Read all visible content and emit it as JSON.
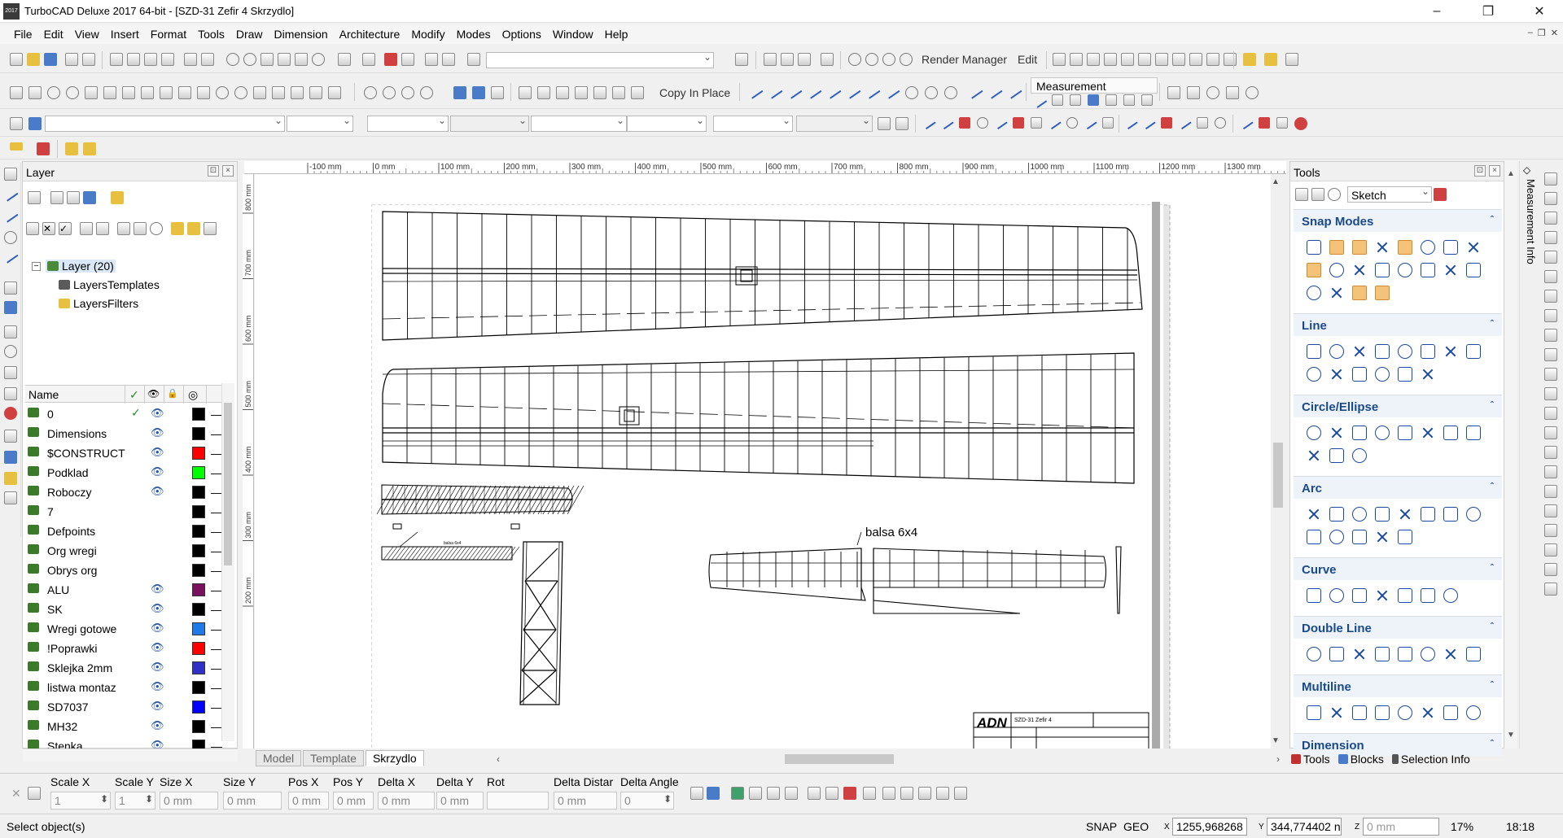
{
  "window": {
    "title": "TurboCAD Deluxe 2017 64-bit - [SZD-31 Zefir 4 Skrzydlo]",
    "icon_text": "2017",
    "minimize": "–",
    "maximize": "❐",
    "close": "✕"
  },
  "menu": [
    "File",
    "Edit",
    "View",
    "Insert",
    "Format",
    "Tools",
    "Draw",
    "Dimension",
    "Architecture",
    "Modify",
    "Modes",
    "Options",
    "Window",
    "Help"
  ],
  "mdi_buttons": [
    "–",
    "❐",
    "✕"
  ],
  "toolbar": {
    "render_manager": "Render Manager",
    "edit": "Edit",
    "copy_in_place": "Copy In Place",
    "measurement": "Measurement"
  },
  "layer_panel": {
    "title": "Layer",
    "tree_root": "Layer (20)",
    "tree_children": [
      "LayersTemplates",
      "LayersFilters"
    ],
    "columns": {
      "name": "Name",
      "check": "✓",
      "eye": "👁",
      "lock": "🔒",
      "color": "◎"
    },
    "rows": [
      {
        "name": "0",
        "current": "✓",
        "visible": "👁",
        "color": "#000000",
        "dash": "—"
      },
      {
        "name": "Dimensions",
        "current": "",
        "visible": "👁",
        "color": "#000000",
        "dash": "—"
      },
      {
        "name": "$CONSTRUCT",
        "current": "",
        "visible": "👁",
        "color": "#ff0000",
        "dash": "—"
      },
      {
        "name": "Podklad",
        "current": "",
        "visible": "👁",
        "color": "#00ff00",
        "dash": "—"
      },
      {
        "name": "Roboczy",
        "current": "",
        "visible": "👁",
        "color": "#000000",
        "dash": "—"
      },
      {
        "name": "7",
        "current": "",
        "visible": "",
        "color": "#000000",
        "dash": "—"
      },
      {
        "name": "Defpoints",
        "current": "",
        "visible": "",
        "color": "#000000",
        "dash": "—"
      },
      {
        "name": "Org wregi",
        "current": "",
        "visible": "",
        "color": "#000000",
        "dash": "—"
      },
      {
        "name": "Obrys org",
        "current": "",
        "visible": "",
        "color": "#000000",
        "dash": "—"
      },
      {
        "name": "ALU",
        "current": "",
        "visible": "👁",
        "color": "#7a1060",
        "dash": "—"
      },
      {
        "name": "SK",
        "current": "",
        "visible": "👁",
        "color": "#000000",
        "dash": "—"
      },
      {
        "name": "Wregi gotowe",
        "current": "",
        "visible": "👁",
        "color": "#1e7ae8",
        "dash": "—"
      },
      {
        "name": "!Poprawki",
        "current": "",
        "visible": "👁",
        "color": "#ff0000",
        "dash": "—"
      },
      {
        "name": "Sklejka 2mm",
        "current": "",
        "visible": "👁",
        "color": "#3030c8",
        "dash": "—"
      },
      {
        "name": "listwa montaz",
        "current": "",
        "visible": "👁",
        "color": "#000000",
        "dash": "—"
      },
      {
        "name": "SD7037",
        "current": "",
        "visible": "👁",
        "color": "#0000ff",
        "dash": "—"
      },
      {
        "name": "MH32",
        "current": "",
        "visible": "👁",
        "color": "#000000",
        "dash": "—"
      },
      {
        "name": "Stenka",
        "current": "",
        "visible": "👁",
        "color": "#000000",
        "dash": "—"
      }
    ]
  },
  "ruler": {
    "h_ticks": [
      "100 mm",
      "0 mm",
      "100 mm",
      "200 mm",
      "300 mm",
      "400 mm",
      "500 mm",
      "600 mm",
      "700 mm",
      "800 mm",
      "900 mm",
      "1000 mm",
      "1100 mm",
      "1200 mm",
      "1300 mm"
    ],
    "h_first_prefix": "-",
    "v_ticks": [
      "800 mm",
      "700 mm",
      "600 mm",
      "500 mm",
      "400 mm",
      "300 mm",
      "200 mm"
    ]
  },
  "drawing": {
    "label_balsa": "balsa 6x4",
    "title_block_logo": "ADN",
    "title_block_name": "SZD-31 Zefir 4",
    "small_label": "balsa 6x4"
  },
  "sheet_tabs": [
    "Model",
    "Template",
    "Skrzydlo"
  ],
  "active_sheet": "Skrzydlo",
  "tools_panel": {
    "title": "Tools",
    "mode_select": "Sketch",
    "sections": [
      "Snap Modes",
      "Line",
      "Circle/Ellipse",
      "Arc",
      "Curve",
      "Double Line",
      "Multiline",
      "Dimension"
    ],
    "tabs": [
      "Tools",
      "Blocks",
      "Selection Info"
    ]
  },
  "right_strip": {
    "label": "Measurement Info"
  },
  "inspector": {
    "fields": [
      {
        "label": "Scale X",
        "value": "1"
      },
      {
        "label": "Scale Y",
        "value": "1"
      },
      {
        "label": "Size X",
        "value": "0 mm"
      },
      {
        "label": "Size Y",
        "value": "0 mm"
      },
      {
        "label": "Pos X",
        "value": "0 mm"
      },
      {
        "label": "Pos Y",
        "value": "0 mm"
      },
      {
        "label": "Delta X",
        "value": "0 mm"
      },
      {
        "label": "Delta Y",
        "value": "0 mm"
      },
      {
        "label": "Rot",
        "value": ""
      },
      {
        "label": "Delta Distar",
        "value": "0 mm"
      },
      {
        "label": "Delta Angle",
        "value": "0"
      }
    ]
  },
  "status": {
    "prompt": "Select object(s)",
    "snap": "SNAP",
    "geo": "GEO",
    "x_axis": "X",
    "x_value": "1255,968268",
    "y_axis": "Y",
    "y_value": "344,774402 n",
    "z_axis": "Z",
    "z_value": "0 mm",
    "zoom": "17%",
    "time": "18:18"
  }
}
